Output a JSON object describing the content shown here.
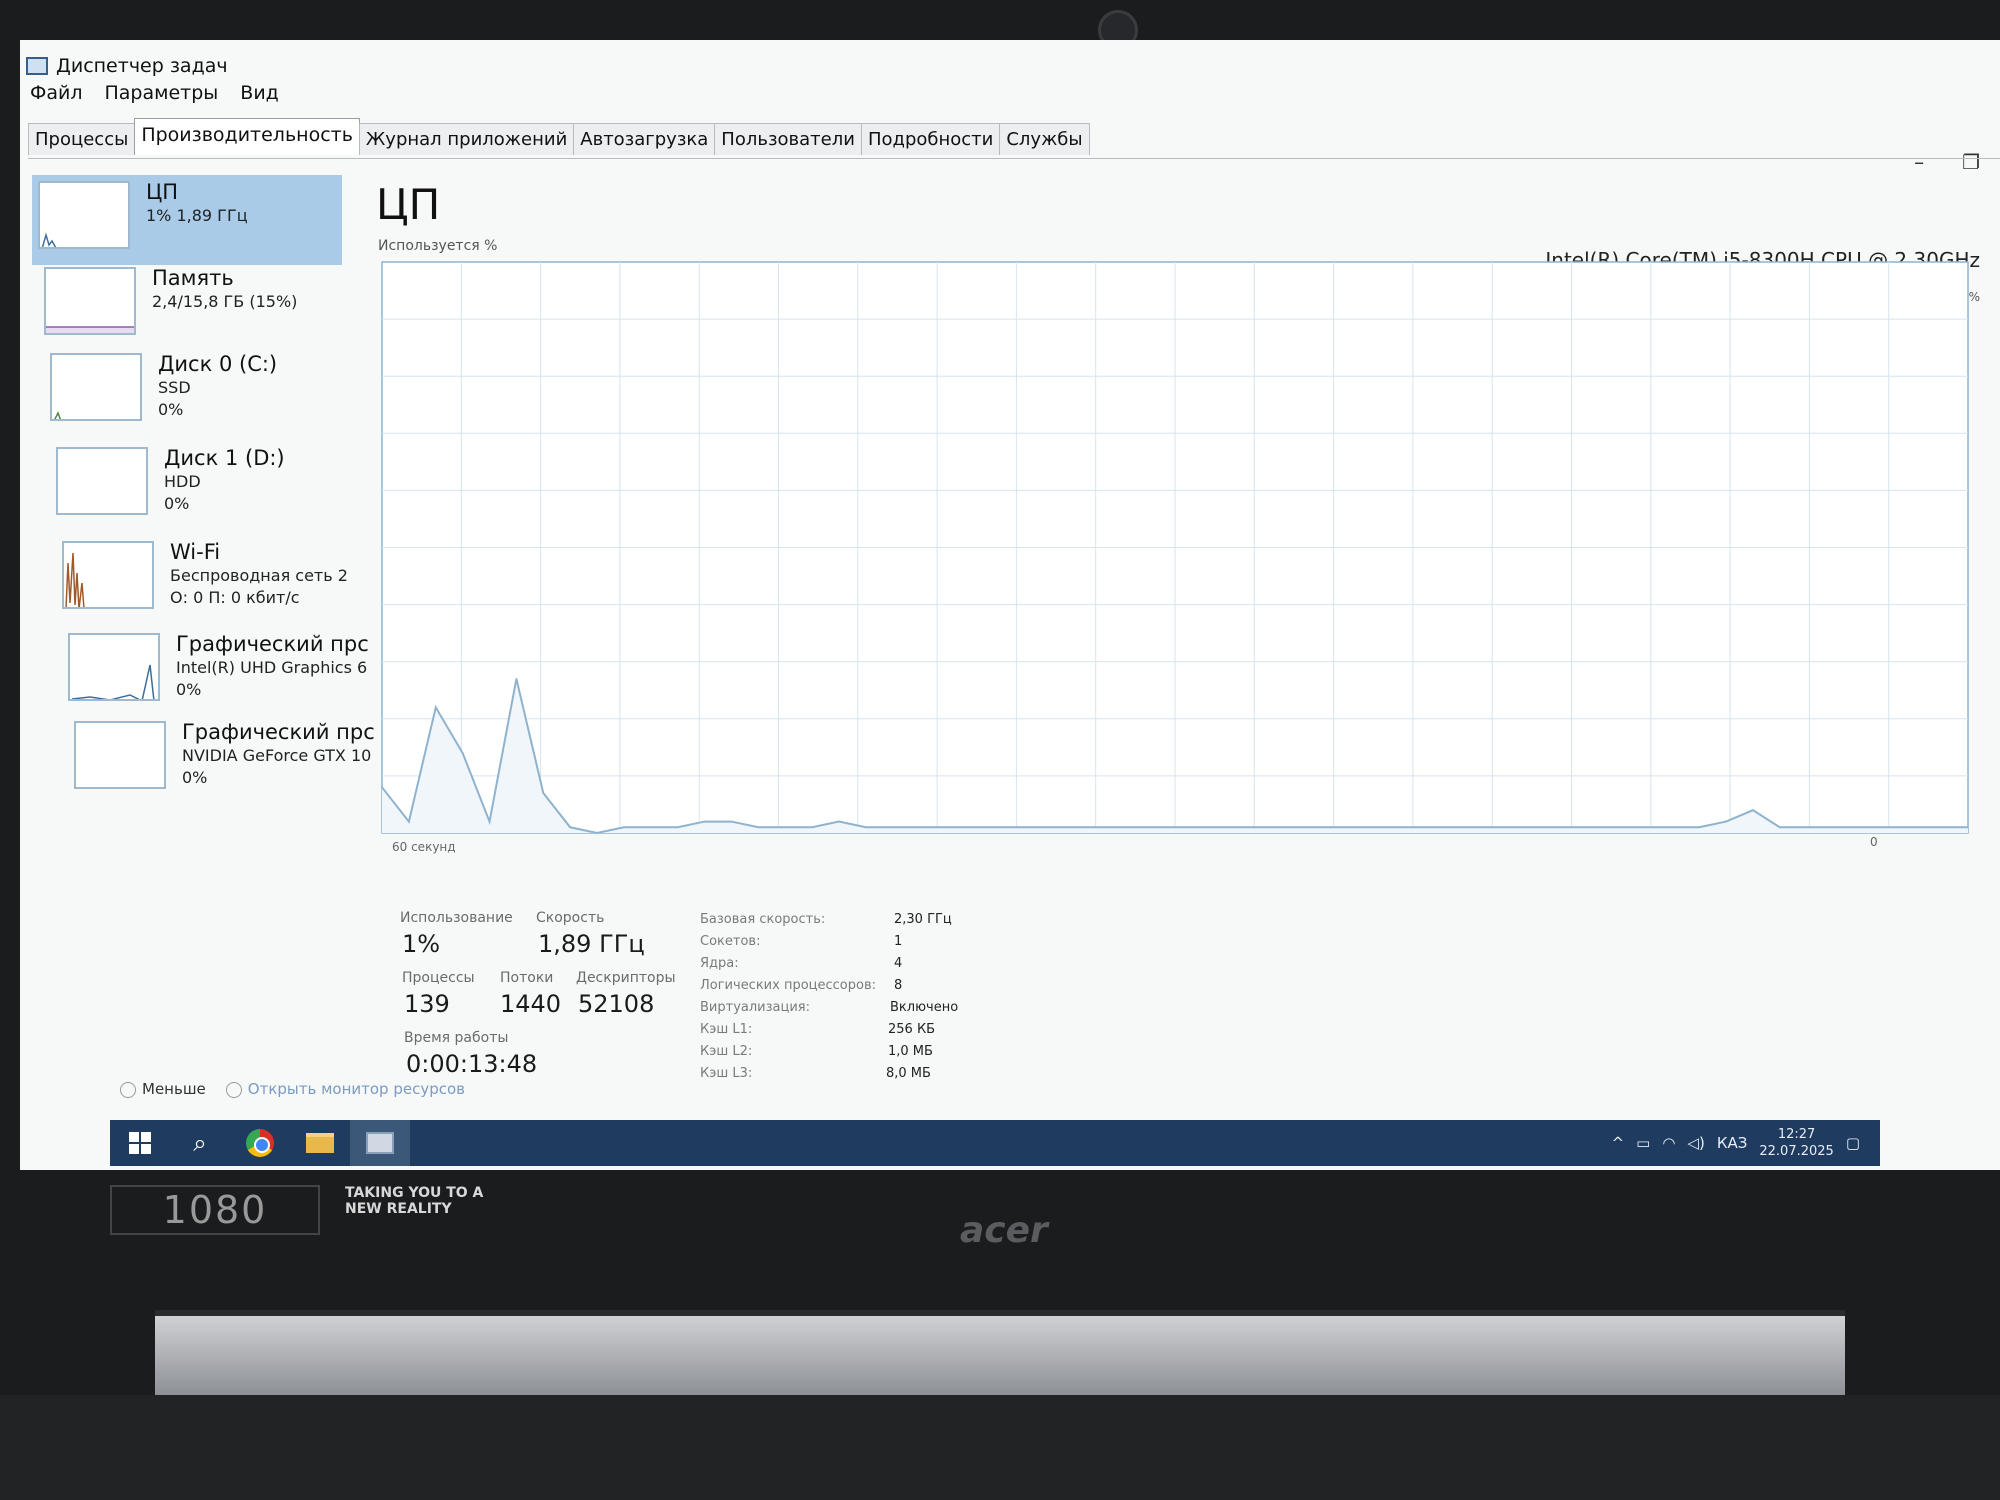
{
  "window": {
    "title": "Диспетчер задач"
  },
  "menu": [
    "Файл",
    "Параметры",
    "Вид"
  ],
  "tabs": [
    "Процессы",
    "Производительность",
    "Журнал приложений",
    "Автозагрузка",
    "Пользователи",
    "Подробности",
    "Службы"
  ],
  "active_tab": "Производительность",
  "sidebar": {
    "items": [
      {
        "title": "ЦП",
        "sub1": "1% 1,89 ГГц",
        "sub2": ""
      },
      {
        "title": "Память",
        "sub1": "2,4/15,8 ГБ (15%)",
        "sub2": ""
      },
      {
        "title": "Диск 0 (C:)",
        "sub1": "SSD",
        "sub2": "0%"
      },
      {
        "title": "Диск 1 (D:)",
        "sub1": "HDD",
        "sub2": "0%"
      },
      {
        "title": "Wi-Fi",
        "sub1": "Беспроводная сеть 2",
        "sub2": "О: 0 П: 0 кбит/с"
      },
      {
        "title": "Графический прс",
        "sub1": "Intel(R) UHD Graphics 6",
        "sub2": "0%"
      },
      {
        "title": "Графический прс",
        "sub1": "NVIDIA GeForce GTX 10",
        "sub2": "0%"
      }
    ]
  },
  "main": {
    "heading": "ЦП",
    "cpu_model": "Intel(R) Core(TM) i5-8300H CPU @ 2.30GHz",
    "usage_label": "Используется %",
    "max_label": "100%",
    "seconds_label": "60 секунд",
    "zero_label": "0"
  },
  "chart_data": {
    "type": "line",
    "title": "",
    "xlabel": "60 секунд",
    "ylabel": "Используется %",
    "ylim": [
      0,
      100
    ],
    "series": [
      {
        "values": [
          8,
          2,
          22,
          14,
          2,
          27,
          7,
          1,
          0,
          1,
          1,
          1,
          2,
          2,
          1,
          1,
          1,
          2,
          1,
          1,
          1,
          1,
          1,
          1,
          1,
          1,
          1,
          1,
          1,
          1,
          1,
          1,
          1,
          1,
          1,
          1,
          1,
          1,
          1,
          1,
          1,
          1,
          1,
          1,
          1,
          1,
          1,
          1,
          1,
          1,
          2,
          4,
          1,
          1,
          1,
          1,
          1,
          1,
          1,
          1
        ]
      }
    ]
  },
  "stats": {
    "usage_label": "Использование",
    "usage_value": "1%",
    "speed_label": "Скорость",
    "speed_value": "1,89 ГГц",
    "processes_label": "Процессы",
    "processes_value": "139",
    "threads_label": "Потоки",
    "threads_value": "1440",
    "handles_label": "Дескрипторы",
    "handles_value": "52108",
    "uptime_label": "Время работы",
    "uptime_value": "0:00:13:48"
  },
  "details": [
    {
      "label": "Базовая скорость:",
      "value": "2,30 ГГц"
    },
    {
      "label": "Сокетов:",
      "value": "1"
    },
    {
      "label": "Ядра:",
      "value": "4"
    },
    {
      "label": "Логических процессоров:",
      "value": "8"
    },
    {
      "label": "Виртуализация:",
      "value": "Включено"
    },
    {
      "label": "Кэш L1:",
      "value": "256 КБ"
    },
    {
      "label": "Кэш L2:",
      "value": "1,0 МБ"
    },
    {
      "label": "Кэш L3:",
      "value": "8,0 МБ"
    }
  ],
  "footer": {
    "less_label": "Меньше",
    "monitor_label": "Открыть монитор ресурсов"
  },
  "taskbar": {
    "lang": "КАЗ",
    "time": "12:27",
    "date": "22.07.2025"
  },
  "hardware": {
    "sticker": "1080",
    "promo_line1": "TAKING YOU TO A",
    "promo_line2": "NEW REALITY",
    "brand": "acer"
  },
  "colors": {
    "graph_line": "#8fb3cf",
    "graph_grid": "#d6e4ee",
    "selected_item": "#a9cbe8",
    "taskbar": "#1f3b60"
  }
}
